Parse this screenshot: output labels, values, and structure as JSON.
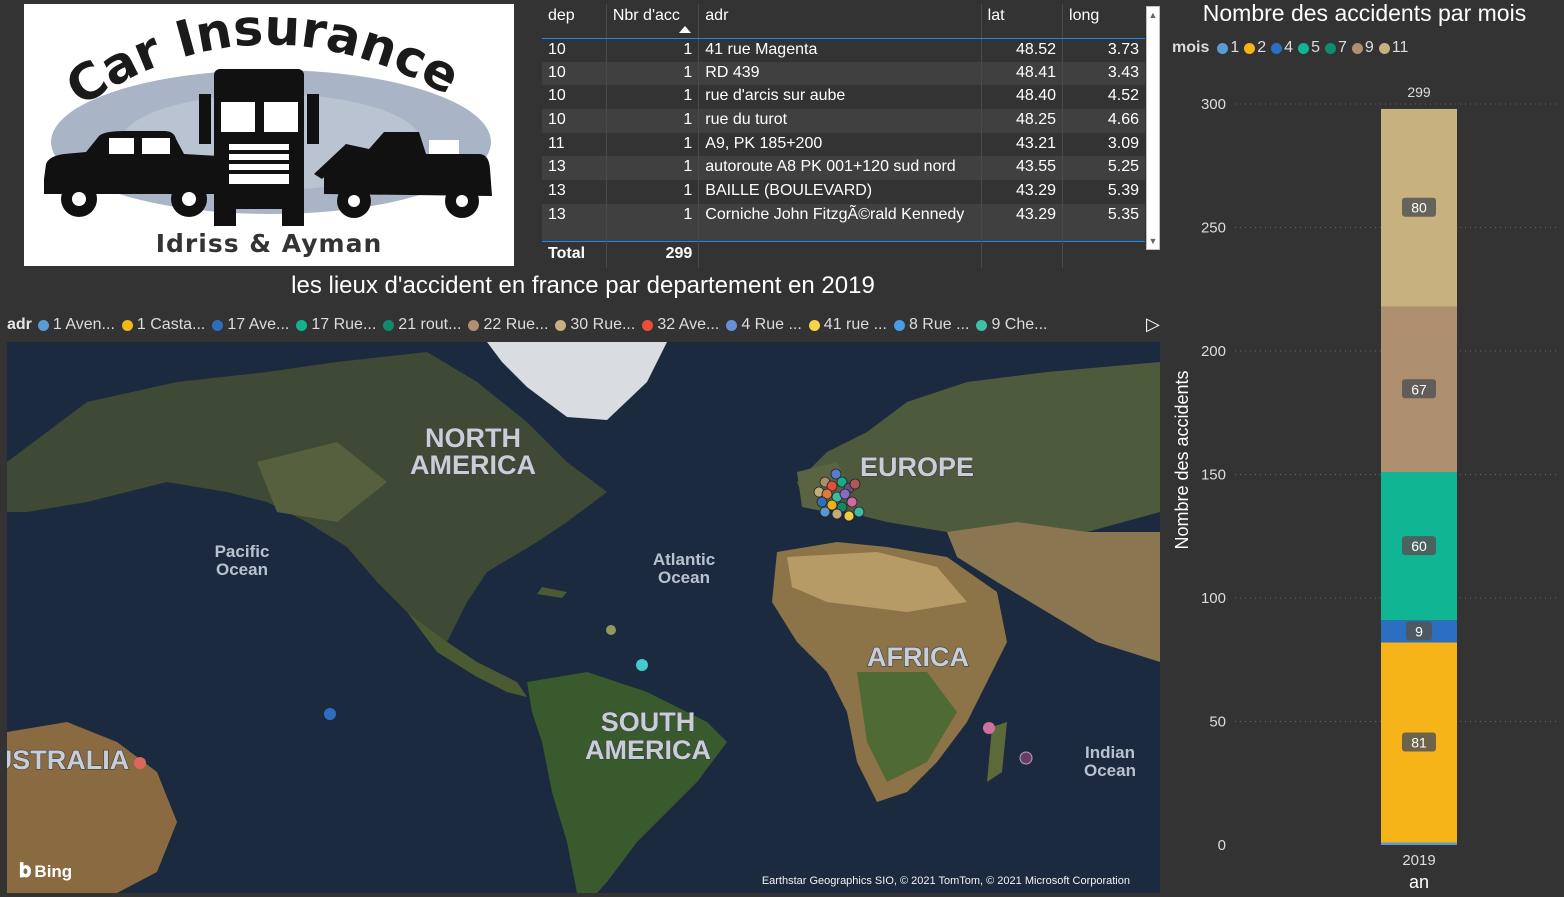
{
  "logo": {
    "title": "Car Insurance",
    "subtitle": "Idriss & Ayman"
  },
  "table": {
    "headers": [
      "dep",
      "Nbr d'acc",
      "adr",
      "lat",
      "long"
    ],
    "rows": [
      {
        "dep": "10",
        "nbr": "1",
        "adr": "41 rue Magenta",
        "lat": "48.52",
        "long": "3.73"
      },
      {
        "dep": "10",
        "nbr": "1",
        "adr": "RD 439",
        "lat": "48.41",
        "long": "3.43"
      },
      {
        "dep": "10",
        "nbr": "1",
        "adr": "rue d'arcis sur aube",
        "lat": "48.40",
        "long": "4.52"
      },
      {
        "dep": "10",
        "nbr": "1",
        "adr": "rue du turot",
        "lat": "48.25",
        "long": "4.66"
      },
      {
        "dep": "11",
        "nbr": "1",
        "adr": "A9, PK 185+200",
        "lat": "43.21",
        "long": "3.09"
      },
      {
        "dep": "13",
        "nbr": "1",
        "adr": "autoroute A8 PK 001+120 sud nord",
        "lat": "43.55",
        "long": "5.25"
      },
      {
        "dep": "13",
        "nbr": "1",
        "adr": "BAILLE (BOULEVARD)",
        "lat": "43.29",
        "long": "5.39"
      },
      {
        "dep": "13",
        "nbr": "1",
        "adr": "Corniche John FitzgÃ©rald Kennedy",
        "lat": "43.29",
        "long": "5.35"
      }
    ],
    "total_label": "Total",
    "total_value": "299"
  },
  "map": {
    "title": "les lieux d'accident en france par departement en 2019",
    "legend_label": "adr",
    "legend_items": [
      {
        "label": "1 Aven...",
        "color": "#5b9bd5"
      },
      {
        "label": "1 Casta...",
        "color": "#f2b818"
      },
      {
        "label": "17 Ave...",
        "color": "#2e6fbd"
      },
      {
        "label": "17 Rue...",
        "color": "#12b38f"
      },
      {
        "label": "21 rout...",
        "color": "#118a6b"
      },
      {
        "label": "22 Rue...",
        "color": "#b09070"
      },
      {
        "label": "30 Rue...",
        "color": "#c9b07f"
      },
      {
        "label": "32 Ave...",
        "color": "#e8503a"
      },
      {
        "label": "4 Rue ...",
        "color": "#6a8ed8"
      },
      {
        "label": "41 rue ...",
        "color": "#f5d547"
      },
      {
        "label": "8 Rue ...",
        "color": "#4a9be8"
      },
      {
        "label": "9 Che...",
        "color": "#3fbfa8"
      }
    ],
    "region_labels": {
      "north_america_1": "NORTH",
      "north_america_2": "AMERICA",
      "europe": "EUROPE",
      "africa": "AFRICA",
      "south_america_1": "SOUTH",
      "south_america_2": "AMERICA",
      "australia": "USTRALIA",
      "pacific_1": "Pacific",
      "pacific_2": "Ocean",
      "atlantic_1": "Atlantic",
      "atlantic_2": "Ocean",
      "indian_1": "Indian",
      "indian_2": "Ocean"
    },
    "provider": "Bing",
    "copyright": "Earthstar Geographics SIO, © 2021 TomTom, © 2021 Microsoft Corporation"
  },
  "chart_data": {
    "type": "bar",
    "title": "Nombre des accidents par mois",
    "legend_label": "mois",
    "xlabel": "an",
    "ylabel": "Nombre des accidents",
    "categories": [
      "2019"
    ],
    "ylim": [
      0,
      300
    ],
    "yticks": [
      0,
      50,
      100,
      150,
      200,
      250,
      300
    ],
    "total_label": "299",
    "series": [
      {
        "name": "1",
        "values": [
          1
        ],
        "color": "#5b9bd5"
      },
      {
        "name": "2",
        "values": [
          81
        ],
        "color": "#f6b419"
      },
      {
        "name": "4",
        "values": [
          9
        ],
        "color": "#2b6fc2"
      },
      {
        "name": "5",
        "values": [
          60
        ],
        "color": "#10b593"
      },
      {
        "name": "7",
        "values": [
          0
        ],
        "color": "#128a6d"
      },
      {
        "name": "9",
        "values": [
          67
        ],
        "color": "#ae8f70"
      },
      {
        "name": "11",
        "values": [
          80
        ],
        "color": "#c7b27f"
      }
    ],
    "stacked": true,
    "grid": true
  }
}
